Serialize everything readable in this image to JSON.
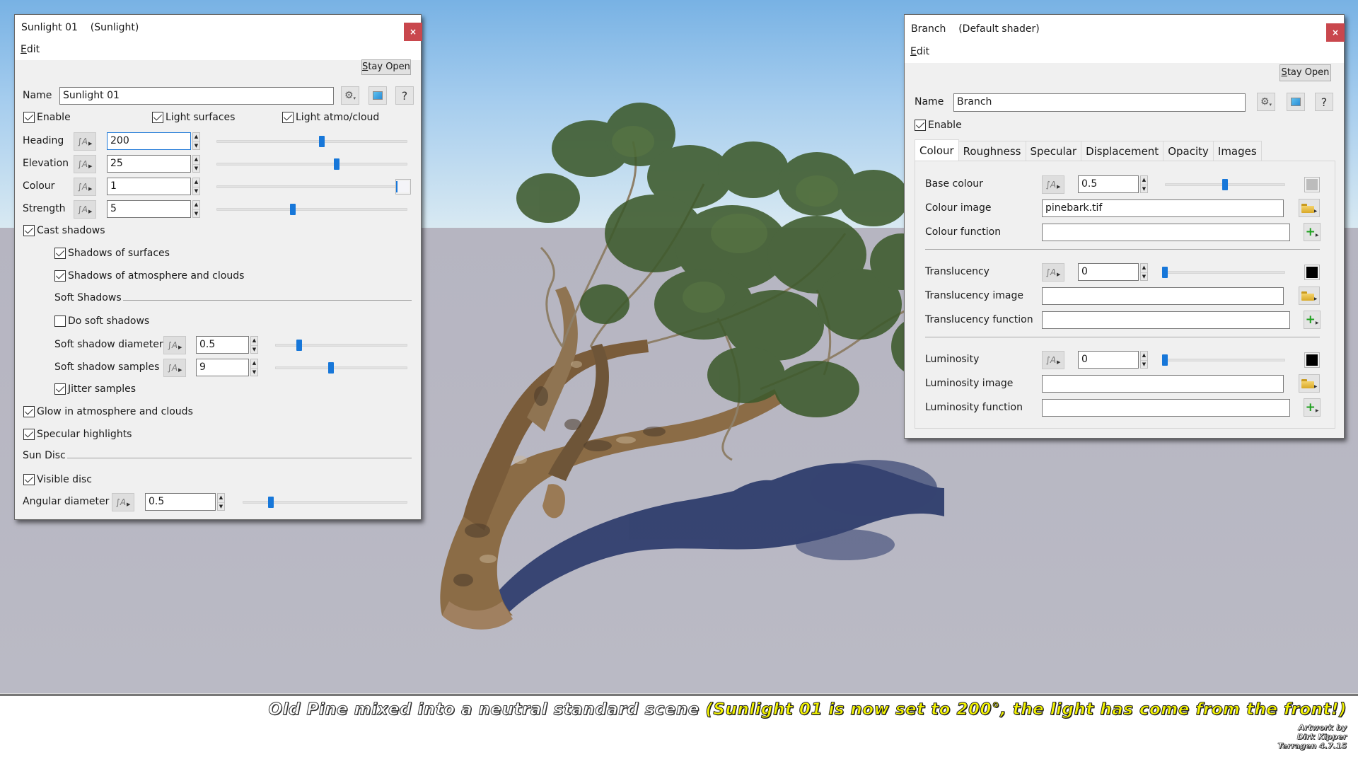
{
  "scene": {
    "description": "3D render of an old twisted pine tree on a neutral grey ground plane with blue sky",
    "colors": {
      "sky_top": "#78b2e4",
      "sky_horizon": "#d8e9f2",
      "ground": "#b8b8c4",
      "shadow": "#2a3a6a",
      "bark": "#8a6a44",
      "foliage": "#3f5a2e"
    }
  },
  "sunlight_panel": {
    "title": "Sunlight 01",
    "subtitle": "(Sunlight)",
    "close_label": "×",
    "menu_edit": "Edit",
    "stay_open": "Stay Open",
    "name_label": "Name",
    "name_value": "Sunlight 01",
    "icons": [
      "gear-icon",
      "preview-icon",
      "help-icon"
    ],
    "help_label": "?",
    "checkboxes_top": [
      {
        "label": "Enable",
        "checked": true
      },
      {
        "label": "Light surfaces",
        "checked": true
      },
      {
        "label": "Light atmo/cloud",
        "checked": true
      }
    ],
    "params": [
      {
        "label": "Heading",
        "value": "200",
        "slider": 0.55,
        "focused": true
      },
      {
        "label": "Elevation",
        "value": "25",
        "slider": 0.63
      },
      {
        "label": "Colour",
        "value": "1",
        "slider": 0.95,
        "swatch": "#f4f4f8"
      },
      {
        "label": "Strength",
        "value": "5",
        "slider": 0.4
      }
    ],
    "cast_shadows": {
      "label": "Cast shadows",
      "checked": true
    },
    "shadows_of_surfaces": {
      "label": "Shadows of surfaces",
      "checked": true
    },
    "shadows_of_atmo": {
      "label": "Shadows of atmosphere and clouds",
      "checked": true
    },
    "soft_shadows_section": "Soft Shadows",
    "do_soft_shadows": {
      "label": "Do soft shadows",
      "checked": false
    },
    "soft_params": [
      {
        "label": "Soft shadow diameter",
        "value": "0.5",
        "slider": 0.18
      },
      {
        "label": "Soft shadow samples",
        "value": "9",
        "slider": 0.42
      }
    ],
    "jitter_samples": {
      "label": "Jitter samples",
      "checked": true
    },
    "glow": {
      "label": "Glow in atmosphere and clouds",
      "checked": true
    },
    "specular": {
      "label": "Specular highlights",
      "checked": true
    },
    "sun_disc_section": "Sun Disc",
    "visible_disc": {
      "label": "Visible disc",
      "checked": true
    },
    "angular_diameter": {
      "label": "Angular diameter",
      "value": "0.5",
      "slider": 0.17
    }
  },
  "shader_panel": {
    "title": "Branch",
    "subtitle": "(Default shader)",
    "close_label": "×",
    "menu_edit": "Edit",
    "stay_open": "Stay Open",
    "name_label": "Name",
    "name_value": "Branch",
    "help_label": "?",
    "enable": {
      "label": "Enable",
      "checked": true
    },
    "tabs": [
      {
        "label": "Colour",
        "active": true
      },
      {
        "label": "Roughness",
        "active": false
      },
      {
        "label": "Specular",
        "active": false
      },
      {
        "label": "Displacement",
        "active": false
      },
      {
        "label": "Opacity",
        "active": false
      },
      {
        "label": "Images",
        "active": false
      }
    ],
    "groups": [
      {
        "value_label": "Base colour",
        "value": "0.5",
        "slider": 0.5,
        "swatch": "#bcbcbc",
        "image_label": "Colour image",
        "image_value": "pinebark.tif",
        "function_label": "Colour function",
        "function_value": ""
      },
      {
        "value_label": "Translucency",
        "value": "0",
        "slider": 0.0,
        "swatch": "#000000",
        "image_label": "Translucency image",
        "image_value": "",
        "function_label": "Translucency function",
        "function_value": ""
      },
      {
        "value_label": "Luminosity",
        "value": "0",
        "slider": 0.0,
        "swatch": "#000000",
        "image_label": "Luminosity image",
        "image_value": "",
        "function_label": "Luminosity function",
        "function_value": ""
      }
    ]
  },
  "caption": {
    "main": "Old Pine mixed into a neutral standard scene ",
    "highlight": "(Sunlight 01 is now set to 200°, the light has come from the front!)",
    "credit_lines": [
      "Artwork by",
      "Dirk Kipper",
      "Terragen 4.7.15"
    ]
  }
}
